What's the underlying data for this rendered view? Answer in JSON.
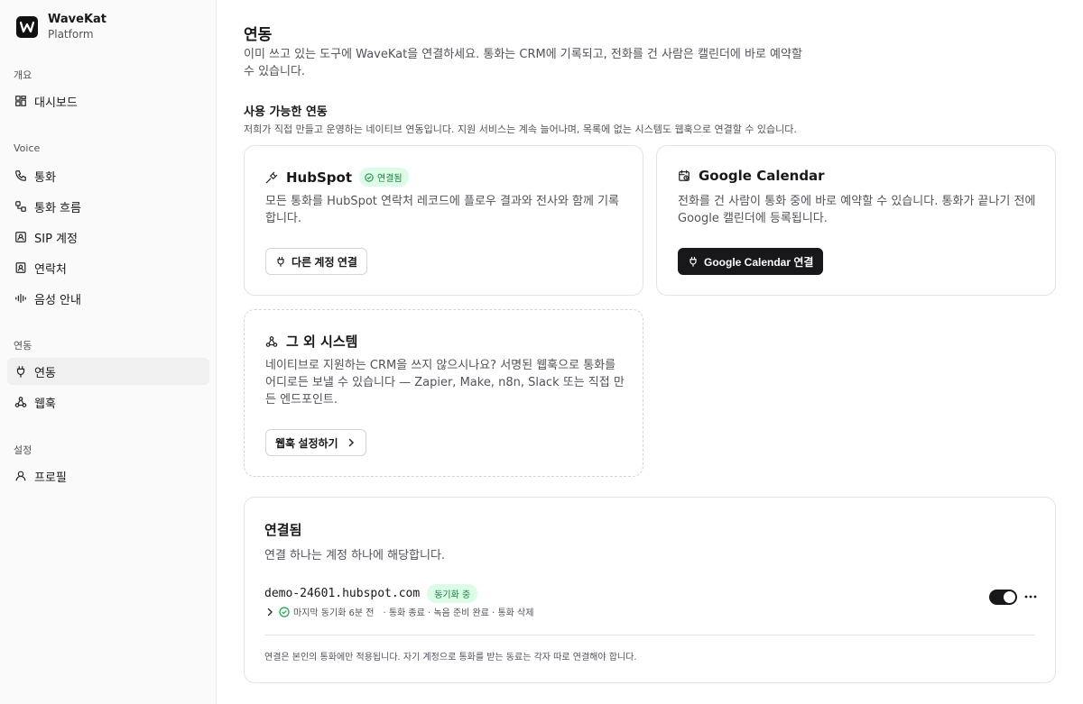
{
  "brand": {
    "name": "WaveKat",
    "subtitle": "Platform"
  },
  "sidebar": {
    "sections": [
      {
        "label": "개요",
        "items": [
          {
            "label": "대시보드",
            "icon": "dashboard-icon"
          }
        ]
      },
      {
        "label": "Voice",
        "items": [
          {
            "label": "통화",
            "icon": "phone-icon"
          },
          {
            "label": "통화 흐름",
            "icon": "workflow-icon"
          },
          {
            "label": "SIP 계정",
            "icon": "sip-account-icon"
          },
          {
            "label": "연락처",
            "icon": "contacts-icon"
          },
          {
            "label": "음성 안내",
            "icon": "audio-waveform-icon"
          }
        ]
      },
      {
        "label": "연동",
        "items": [
          {
            "label": "연동",
            "icon": "plug-icon",
            "active": true
          },
          {
            "label": "웹훅",
            "icon": "webhook-icon"
          }
        ]
      },
      {
        "label": "설정",
        "items": [
          {
            "label": "프로필",
            "icon": "user-icon"
          }
        ]
      }
    ]
  },
  "page": {
    "title": "연동",
    "description": "이미 쓰고 있는 도구에 WaveKat을 연결하세요. 통화는 CRM에 기록되고, 전화를 건 사람은 캘린더에 바로 예약할 수 있습니다."
  },
  "available": {
    "title": "사용 가능한 연동",
    "description": "저희가 직접 만들고 운영하는 네이티브 연동입니다. 지원 서비스는 계속 늘어나며, 목록에 없는 시스템도 웹훅으로 연결할 수 있습니다.",
    "hubspot": {
      "title": "HubSpot",
      "badge": "연결됨",
      "description": "모든 통화를 HubSpot 연락처 레코드에 플로우 결과와 전사와 함께 기록합니다.",
      "button": "다른 계정 연결"
    },
    "google": {
      "title": "Google Calendar",
      "description": "전화를 건 사람이 통화 중에 바로 예약할 수 있습니다. 통화가 끝나기 전에 Google 캘린더에 등록됩니다.",
      "button": "Google Calendar 연결"
    },
    "other": {
      "title": "그 외 시스템",
      "description": "네이티브로 지원하는 CRM을 쓰지 않으시나요? 서명된 웹훅으로 통화를 어디로든 보낼 수 있습니다 — Zapier, Make, n8n, Slack 또는 직접 만든 엔드포인트.",
      "button": "웹훅 설정하기"
    }
  },
  "connected": {
    "title": "연결됨",
    "description": "연결 하나는 계정 하나에 해당합니다.",
    "account": {
      "name": "demo-24601.hubspot.com",
      "badge": "동기화 중",
      "last_sync": "마지막 동기화 6분 전",
      "events": "· 통화 종료 · 녹음 준비 완료 · 통화 삭제",
      "enabled": true
    },
    "footnote": "연결은 본인의 통화에만 적용됩니다. 자기 계정으로 통화를 받는 동료는 각자 따로 연결해야 합니다."
  },
  "colors": {
    "accent": "#18181b",
    "success_bg": "#dcfce7",
    "success_text": "#15803d"
  }
}
